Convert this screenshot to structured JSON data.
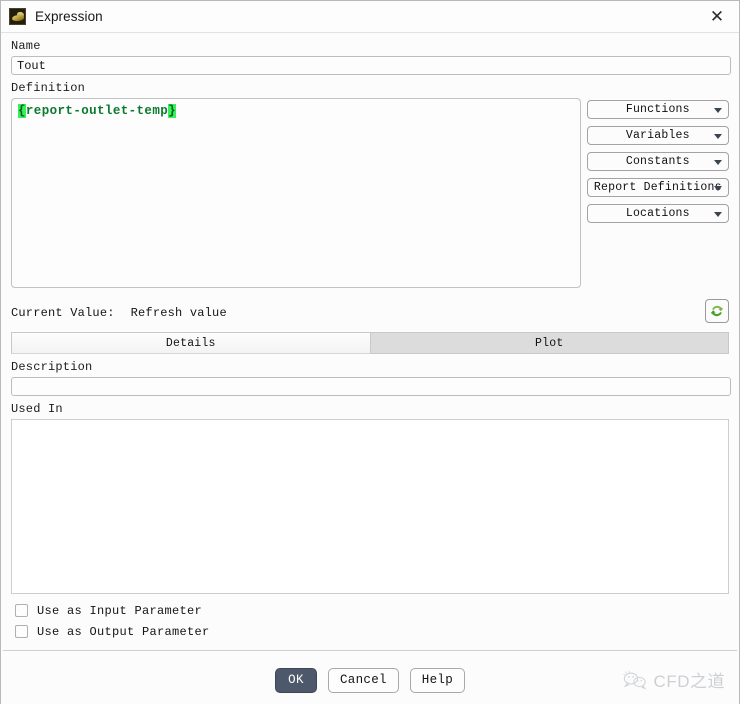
{
  "window": {
    "title": "Expression",
    "icon": "expression-app-icon",
    "close_icon": "close-icon"
  },
  "form": {
    "name_label": "Name",
    "name_value": "Tout",
    "name_placeholder": "",
    "definition_label": "Definition",
    "definition_open_brace": "{",
    "definition_identifier": "report-outlet-temp",
    "definition_close_brace": "}",
    "definition_full": "{report-outlet-temp}"
  },
  "insert_menus": [
    {
      "label": "Functions",
      "icon": "chevron-down-icon"
    },
    {
      "label": "Variables",
      "icon": "chevron-down-icon"
    },
    {
      "label": "Constants",
      "icon": "chevron-down-icon"
    },
    {
      "label": "Report Definitions",
      "icon": "chevron-down-icon"
    },
    {
      "label": "Locations",
      "icon": "chevron-down-icon"
    }
  ],
  "current_value": {
    "label": "Current Value:",
    "value": "Refresh value",
    "refresh_icon": "refresh-icon"
  },
  "tabs": [
    {
      "label": "Details",
      "active": true
    },
    {
      "label": "Plot",
      "active": false
    }
  ],
  "details": {
    "description_label": "Description",
    "description_value": "",
    "description_placeholder": "",
    "used_in_label": "Used In",
    "used_in_items": []
  },
  "checkboxes": [
    {
      "label": "Use as Input Parameter",
      "checked": false
    },
    {
      "label": "Use as Output Parameter",
      "checked": false
    }
  ],
  "footer": {
    "ok_label": "OK",
    "cancel_label": "Cancel",
    "help_label": "Help"
  },
  "watermark": {
    "text": "CFD之道",
    "icon": "wechat-icon"
  },
  "colors": {
    "accent_primary": "#4e586b",
    "code_green": "#0a7a2e",
    "brace_highlight": "#37f05a",
    "refresh_green": "#6ab04c",
    "window_bg": "#fcfcfc",
    "tab_inactive": "#dcdcdc"
  }
}
